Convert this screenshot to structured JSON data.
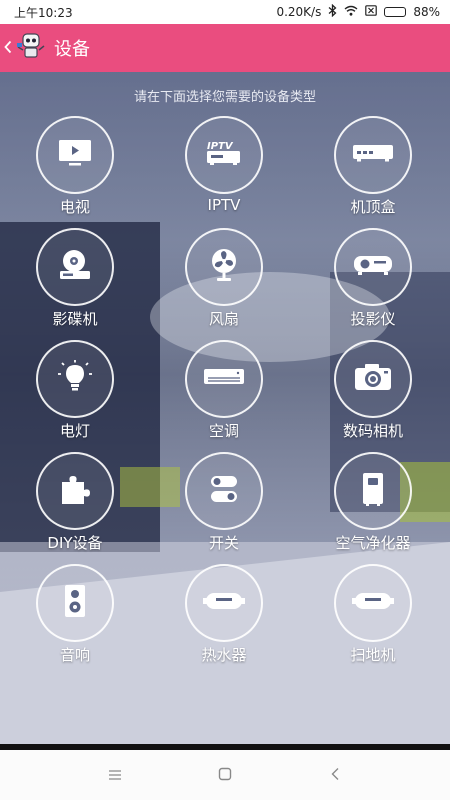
{
  "status_bar": {
    "time": "上午10:23",
    "network_speed": "0.20K/s",
    "battery": "88%",
    "battery_level": 0.88
  },
  "header": {
    "title": "设备",
    "accent_color": "#ea4d7f"
  },
  "main": {
    "hint": "请在下面选择您需要的设备类型"
  },
  "devices": [
    {
      "label": "电视",
      "icon": "tv-icon"
    },
    {
      "label": "IPTV",
      "icon": "iptv-icon"
    },
    {
      "label": "机顶盒",
      "icon": "set-top-box-icon"
    },
    {
      "label": "影碟机",
      "icon": "dvd-player-icon"
    },
    {
      "label": "风扇",
      "icon": "fan-icon"
    },
    {
      "label": "投影仪",
      "icon": "projector-icon"
    },
    {
      "label": "电灯",
      "icon": "light-bulb-icon"
    },
    {
      "label": "空调",
      "icon": "air-conditioner-icon"
    },
    {
      "label": "数码相机",
      "icon": "camera-icon"
    },
    {
      "label": "DIY设备",
      "icon": "puzzle-icon"
    },
    {
      "label": "开关",
      "icon": "switch-icon"
    },
    {
      "label": "空气净化器",
      "icon": "air-purifier-icon"
    },
    {
      "label": "音响",
      "icon": "speaker-icon"
    },
    {
      "label": "热水器",
      "icon": "water-heater-icon"
    },
    {
      "label": "扫地机",
      "icon": "robot-vacuum-icon"
    }
  ],
  "nav_bar": {
    "icons": [
      "menu-icon",
      "home-square-icon",
      "back-icon"
    ]
  }
}
